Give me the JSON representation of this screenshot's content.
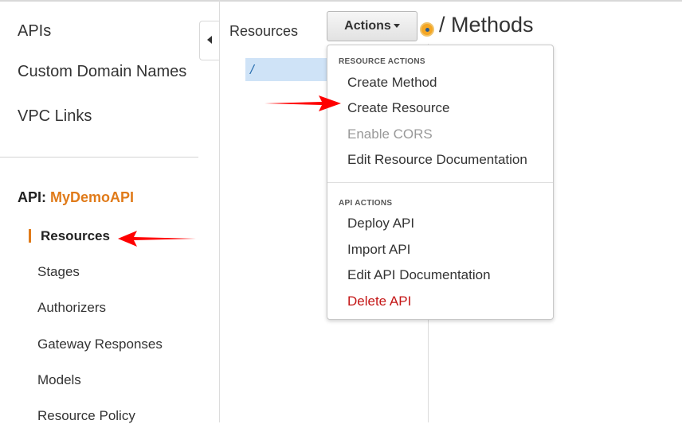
{
  "sidebar": {
    "items": [
      {
        "label": "APIs"
      },
      {
        "label": "Custom Domain Names"
      },
      {
        "label": "VPC Links"
      }
    ],
    "api_prefix": "API:",
    "api_name": "MyDemoAPI",
    "sub_items": [
      {
        "label": "Resources",
        "active": true
      },
      {
        "label": "Stages"
      },
      {
        "label": "Authorizers"
      },
      {
        "label": "Gateway Responses"
      },
      {
        "label": "Models"
      },
      {
        "label": "Resource Policy"
      }
    ]
  },
  "resources": {
    "title": "Resources",
    "tree": [
      {
        "label": "/"
      }
    ]
  },
  "toolbar": {
    "actions_label": "Actions",
    "page_title": "/ Methods"
  },
  "actions_menu": {
    "resource_actions_header": "RESOURCE ACTIONS",
    "resource_actions": [
      {
        "label": "Create Method"
      },
      {
        "label": "Create Resource"
      },
      {
        "label": "Enable CORS",
        "disabled": true
      },
      {
        "label": "Edit Resource Documentation"
      }
    ],
    "api_actions_header": "API ACTIONS",
    "api_actions": [
      {
        "label": "Deploy API"
      },
      {
        "label": "Import API"
      },
      {
        "label": "Edit API Documentation"
      },
      {
        "label": "Delete API",
        "danger": true
      }
    ]
  },
  "colors": {
    "accent": "#e07b1a",
    "selection": "#cfe3f7",
    "danger": "#c41616",
    "annotation_arrow": "#ff0000"
  },
  "icons": [
    "collapse-left-icon",
    "chevron-down-icon",
    "status-dot-icon",
    "red-arrow-icon"
  ]
}
